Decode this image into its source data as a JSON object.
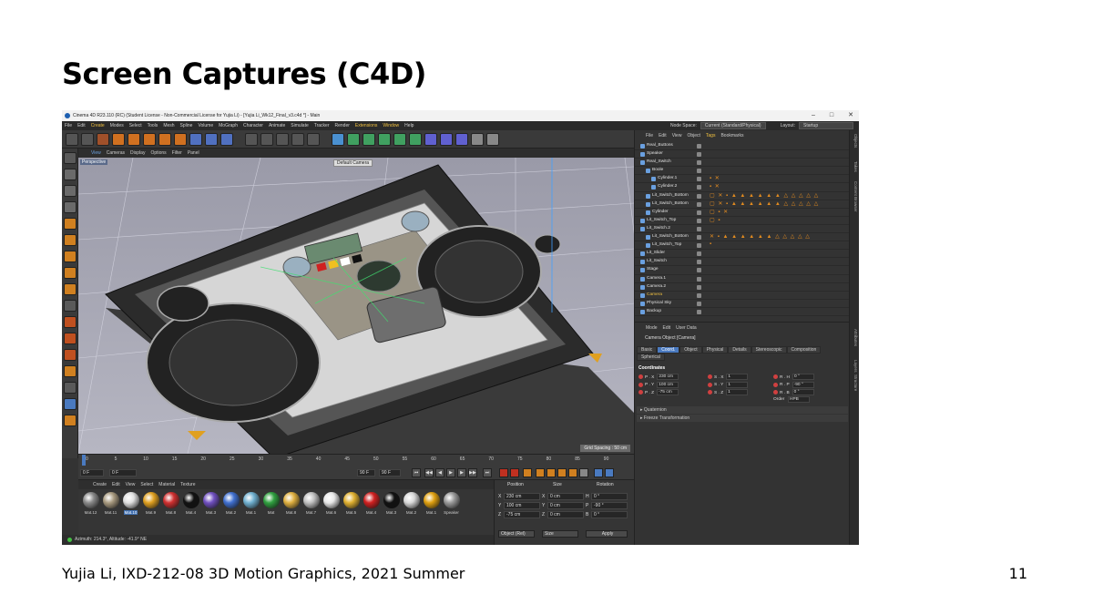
{
  "slide": {
    "title": "Screen Captures (C4D)",
    "footer": "Yujia Li, IXD-212-08 3D Motion Graphics, 2021 Summer",
    "page_number": "11"
  },
  "app": {
    "window_title": "Cinema 4D R23.110 (RC) (Student License - Non-Commercial License for Yujia Li) - [Yujia Li_Wk12_Final_v3.c4d *] - Main",
    "menu": [
      "File",
      "Edit",
      "Create",
      "Modes",
      "Select",
      "Tools",
      "Mesh",
      "Spline",
      "Volume",
      "MoGraph",
      "Character",
      "Animate",
      "Simulate",
      "Tracker",
      "Render",
      "Extensions",
      "Window",
      "Help"
    ],
    "node_space_label": "Node Space:",
    "node_space_value": "Current (Standard/Physical)",
    "layout_label": "Layout:",
    "layout_value": "Startup"
  },
  "viewport": {
    "menu": [
      "View",
      "Cameras",
      "Display",
      "Options",
      "Filter",
      "Panel"
    ],
    "label": "Perspective",
    "camera": "Default Camera",
    "grid_spacing": "Grid Spacing : 50 cm"
  },
  "timeline": {
    "ticks": [
      "0",
      "5",
      "10",
      "15",
      "20",
      "25",
      "30",
      "35",
      "40",
      "45",
      "50",
      "55",
      "60",
      "65",
      "70",
      "75",
      "80",
      "85",
      "90"
    ],
    "current_frame_marker": "0 F",
    "start": "0 F",
    "start2": "0 F",
    "end": "90 F",
    "end2": "90 F"
  },
  "materials": {
    "menu": [
      "Create",
      "Edit",
      "View",
      "Select",
      "Material",
      "Texture"
    ],
    "items": [
      {
        "name": "Mat.12",
        "color": "#8a8a8a"
      },
      {
        "name": "Mat.11",
        "color": "#a89a80"
      },
      {
        "name": "Mat.10",
        "color": "#e0e0e0",
        "selected": true
      },
      {
        "name": "Mat.9",
        "color": "#e0a020"
      },
      {
        "name": "Mat.8",
        "color": "#d03030"
      },
      {
        "name": "Mat.4",
        "color": "#111111"
      },
      {
        "name": "Mat.3",
        "color": "#7050c0"
      },
      {
        "name": "Mat.2",
        "color": "#4070d0"
      },
      {
        "name": "Mat.1",
        "color": "#70b0d0"
      },
      {
        "name": "Mat",
        "color": "#30a040"
      },
      {
        "name": "Mat.8",
        "color": "#e0b040"
      },
      {
        "name": "Mat.7",
        "color": "#c0c0c0"
      },
      {
        "name": "Mat.6",
        "color": "#e8e8e8"
      },
      {
        "name": "Mat.5",
        "color": "#e0b030"
      },
      {
        "name": "Mat.4",
        "color": "#d02020"
      },
      {
        "name": "Mat.3",
        "color": "#111111"
      },
      {
        "name": "Mat.2",
        "color": "#d8d8d8"
      },
      {
        "name": "Mat.1",
        "color": "#e0a010"
      },
      {
        "name": "Speaker",
        "color": "#999999"
      }
    ]
  },
  "coordinates": {
    "headers": [
      "Position",
      "Size",
      "Rotation"
    ],
    "rows": [
      {
        "axis": "X",
        "pos": "230 cm",
        "size_axis": "X",
        "size": "0 cm",
        "rot_axis": "H",
        "rot": "0 °"
      },
      {
        "axis": "Y",
        "pos": "100 cm",
        "size_axis": "Y",
        "size": "0 cm",
        "rot_axis": "P",
        "rot": "-90 °"
      },
      {
        "axis": "Z",
        "pos": "-75 cm",
        "size_axis": "Z",
        "size": "0 cm",
        "rot_axis": "B",
        "rot": "0 °"
      }
    ],
    "mode": "Object (Rel)",
    "size_mode": "Size",
    "apply": "Apply"
  },
  "status": {
    "text": "Azimuth: 214.3°, Altitude: -41.9°  NE"
  },
  "objects": {
    "menu": [
      "File",
      "Edit",
      "View",
      "Object",
      "Tags",
      "Bookmarks"
    ],
    "active_menu": "Tags",
    "items": [
      {
        "name": "Real_Buttons",
        "indent": 0,
        "tags": ""
      },
      {
        "name": "Speaker",
        "indent": 0,
        "tags": ""
      },
      {
        "name": "Real_Switch",
        "indent": 0,
        "tags": ""
      },
      {
        "name": "Boole",
        "indent": 1,
        "tags": ""
      },
      {
        "name": "Cylinder.1",
        "indent": 2,
        "tags": "▪ ✕"
      },
      {
        "name": "Cylinder.2",
        "indent": 2,
        "tags": "▪ ✕"
      },
      {
        "name": "Lit_Switch_Bottom",
        "indent": 1,
        "tags": "▢ ✕ ▪ ▲ ▲ ▲ ▲ ▲ ▲ △ △ △ △ △"
      },
      {
        "name": "Lit_Switch_Bottom",
        "indent": 1,
        "tags": "▢ ✕ ▪ ▲ ▲ ▲ ▲ ▲ ▲ △ △ △ △ △"
      },
      {
        "name": "Cylinder",
        "indent": 1,
        "tags": "▢ ▪ ✕"
      },
      {
        "name": "Lit_Switch_Top",
        "indent": 0,
        "tags": "▢ ▪"
      },
      {
        "name": "Lit_Switch.2",
        "indent": 0,
        "tags": ""
      },
      {
        "name": "Lit_Switch_Bottom",
        "indent": 1,
        "tags": "✕ ▪ ▲ ▲ ▲ ▲ ▲ ▲ △ △ △ △ △"
      },
      {
        "name": "Lit_Switch_Top",
        "indent": 1,
        "tags": "▪"
      },
      {
        "name": "Lit_Slider",
        "indent": 0,
        "tags": ""
      },
      {
        "name": "Lit_Switch",
        "indent": 0,
        "tags": ""
      },
      {
        "name": "Stage",
        "indent": 0,
        "tags": ""
      },
      {
        "name": "Camera.1",
        "indent": 0,
        "tags": ""
      },
      {
        "name": "Camera.2",
        "indent": 0,
        "tags": ""
      },
      {
        "name": "Camera",
        "indent": 0,
        "tags": "",
        "highlight": true
      },
      {
        "name": "Physical Sky",
        "indent": 0,
        "tags": ""
      },
      {
        "name": "Backup",
        "indent": 0,
        "tags": ""
      }
    ]
  },
  "attributes": {
    "menu": [
      "Mode",
      "Edit",
      "User Data"
    ],
    "object_title": "Camera Object [Camera]",
    "tabs": [
      "Basic",
      "Coord.",
      "Object",
      "Physical",
      "Details",
      "Stereoscopic",
      "Composition",
      "Spherical"
    ],
    "active_tab": "Coord.",
    "section": "Coordinates",
    "rows": [
      {
        "p": "P . X",
        "pv": "230 cm",
        "s": "S . X",
        "sv": "1",
        "r": "R . H",
        "rv": "0 °"
      },
      {
        "p": "P . Y",
        "pv": "100 cm",
        "s": "S . Y",
        "sv": "1",
        "r": "R . P",
        "rv": "-90 °"
      },
      {
        "p": "P . Z",
        "pv": "-75 cm",
        "s": "S . Z",
        "sv": "1",
        "r": "R . B",
        "rv": "0 °"
      }
    ],
    "order_label": "Order",
    "order_value": "HPB",
    "fold1": "▸ Quaternion",
    "fold2": "▸ Freeze Transformation"
  },
  "side_tabs": [
    "Objects",
    "Takes",
    "Content Browser",
    "Attributes",
    "Layers",
    "Structure"
  ]
}
